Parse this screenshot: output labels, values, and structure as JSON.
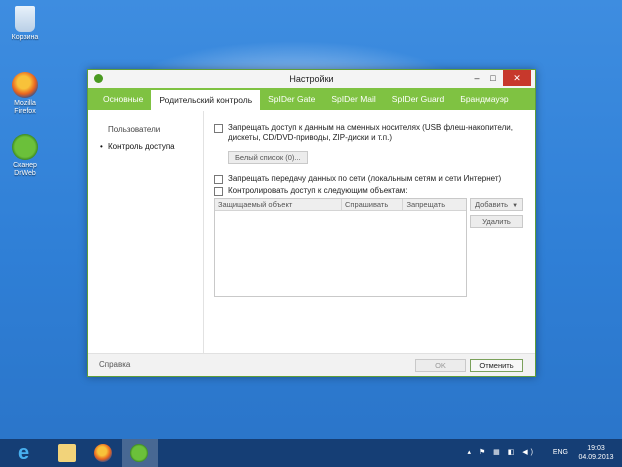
{
  "desktop": {
    "icons": [
      {
        "label": "Корзина"
      },
      {
        "label": "Mozilla\nFirefox"
      },
      {
        "label": "Сканер\nDrWeb"
      }
    ]
  },
  "window": {
    "title": "Настройки",
    "tabs": [
      {
        "label": "Основные"
      },
      {
        "label": "Родительский контроль",
        "active": true
      },
      {
        "label": "SpIDer Gate"
      },
      {
        "label": "SpIDer Mail"
      },
      {
        "label": "SpIDer Guard"
      },
      {
        "label": "Брандмауэр"
      }
    ],
    "left_nav": [
      {
        "label": "Пользователи"
      },
      {
        "label": "Контроль доступа",
        "selected": true
      }
    ],
    "options": {
      "removable": "Запрещать доступ к данным на сменных носителях (USB флеш-накопители, дискеты, CD/DVD-приводы, ZIP-диски и т.п.)",
      "whitelist_button": "Белый список (0)...",
      "network": "Запрещать передачу данных по сети (локальным сетям и сети Интернет)",
      "control_objects": "Контролировать доступ к следующим объектам:"
    },
    "table": {
      "columns": [
        "Защищаемый объект",
        "Спрашивать",
        "Запрещать"
      ]
    },
    "buttons": {
      "add": "Добавить",
      "remove": "Удалить",
      "ok": "OK",
      "cancel": "Отменить"
    },
    "footer": {
      "help": "Справка"
    }
  },
  "taskbar": {
    "language": "ENG",
    "time": "19:03",
    "date": "04.09.2013"
  }
}
